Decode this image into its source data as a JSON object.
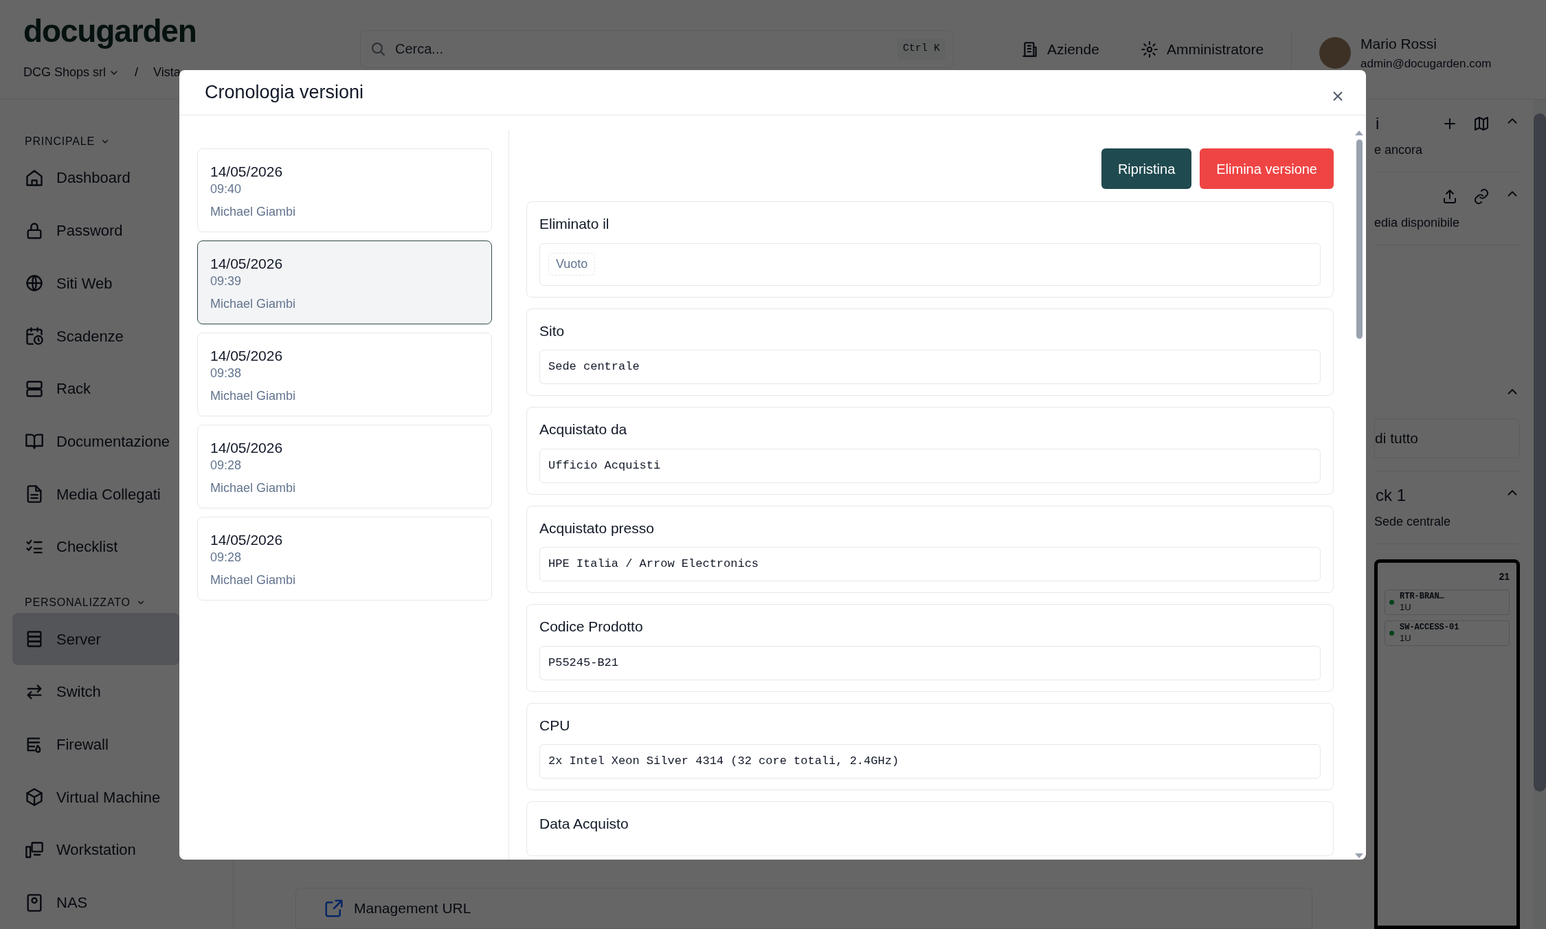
{
  "header": {
    "logo": "docugarden",
    "breadcrumb": [
      {
        "label": "DCG Shops srl",
        "dropdown": true
      },
      {
        "label": "Vista",
        "dropdown": false
      }
    ],
    "breadcrumb_separator": "/",
    "search": {
      "placeholder": "Cerca...",
      "shortcut": "Ctrl K"
    },
    "nav": [
      {
        "label": "Aziende"
      },
      {
        "label": "Amministratore"
      }
    ],
    "user": {
      "name": "Mario Rossi",
      "email": "admin@docugarden.com"
    }
  },
  "sidebar": {
    "sections": [
      {
        "title": "PRINCIPALE",
        "items": [
          {
            "label": "Dashboard",
            "selected": false
          },
          {
            "label": "Password",
            "selected": false
          },
          {
            "label": "Siti Web",
            "selected": false
          },
          {
            "label": "Scadenze",
            "selected": false
          },
          {
            "label": "Rack",
            "selected": false
          },
          {
            "label": "Documentazione",
            "selected": false
          },
          {
            "label": "Media Collegati",
            "selected": false
          },
          {
            "label": "Checklist",
            "selected": false
          }
        ]
      },
      {
        "title": "PERSONALIZZATO",
        "items": [
          {
            "label": "Server",
            "selected": true
          },
          {
            "label": "Switch",
            "selected": false
          },
          {
            "label": "Firewall",
            "selected": false
          },
          {
            "label": "Virtual Machine",
            "selected": false
          },
          {
            "label": "Workstation",
            "selected": false
          },
          {
            "label": "NAS",
            "selected": false
          }
        ]
      }
    ]
  },
  "main": {
    "bottom_card": "Management URL"
  },
  "right_panel": {
    "sections": [
      {
        "title": "i",
        "subtitle": "e ancora"
      },
      {
        "subtitle": "edia disponibile"
      },
      {
        "row": "di tutto"
      },
      {
        "title": "ck 1",
        "subtitle": "Sede centrale"
      }
    ],
    "rack": {
      "unit": "21",
      "devices": [
        {
          "name": "RTR-BRAN…",
          "size": "1U"
        },
        {
          "name": "SW-ACCESS-01",
          "size": "1U"
        }
      ]
    }
  },
  "modal": {
    "title": "Cronologia versioni",
    "versions": [
      {
        "date": "14/05/2026",
        "time": "09:40",
        "author": "Michael Giambi",
        "selected": false
      },
      {
        "date": "14/05/2026",
        "time": "09:39",
        "author": "Michael Giambi",
        "selected": true
      },
      {
        "date": "14/05/2026",
        "time": "09:38",
        "author": "Michael Giambi",
        "selected": false
      },
      {
        "date": "14/05/2026",
        "time": "09:28",
        "author": "Michael Giambi",
        "selected": false
      },
      {
        "date": "14/05/2026",
        "time": "09:28",
        "author": "Michael Giambi",
        "selected": false
      }
    ],
    "buttons": [
      {
        "label": "Ripristina",
        "kind": "primary"
      },
      {
        "label": "Elimina versione",
        "kind": "danger"
      }
    ],
    "fields": [
      {
        "label": "Eliminato il",
        "value": "Vuoto",
        "kind": "empty"
      },
      {
        "label": "Sito",
        "value": "Sede centrale",
        "kind": "value"
      },
      {
        "label": "Acquistato da",
        "value": "Ufficio Acquisti",
        "kind": "value"
      },
      {
        "label": "Acquistato presso",
        "value": "HPE Italia / Arrow Electronics",
        "kind": "value"
      },
      {
        "label": "Codice Prodotto",
        "value": "P55245-B21",
        "kind": "value"
      },
      {
        "label": "CPU",
        "value": "2x Intel Xeon Silver 4314 (32 core totali, 2.4GHz)",
        "kind": "value"
      },
      {
        "label": "Data Acquisto",
        "kind": "cut"
      }
    ]
  }
}
